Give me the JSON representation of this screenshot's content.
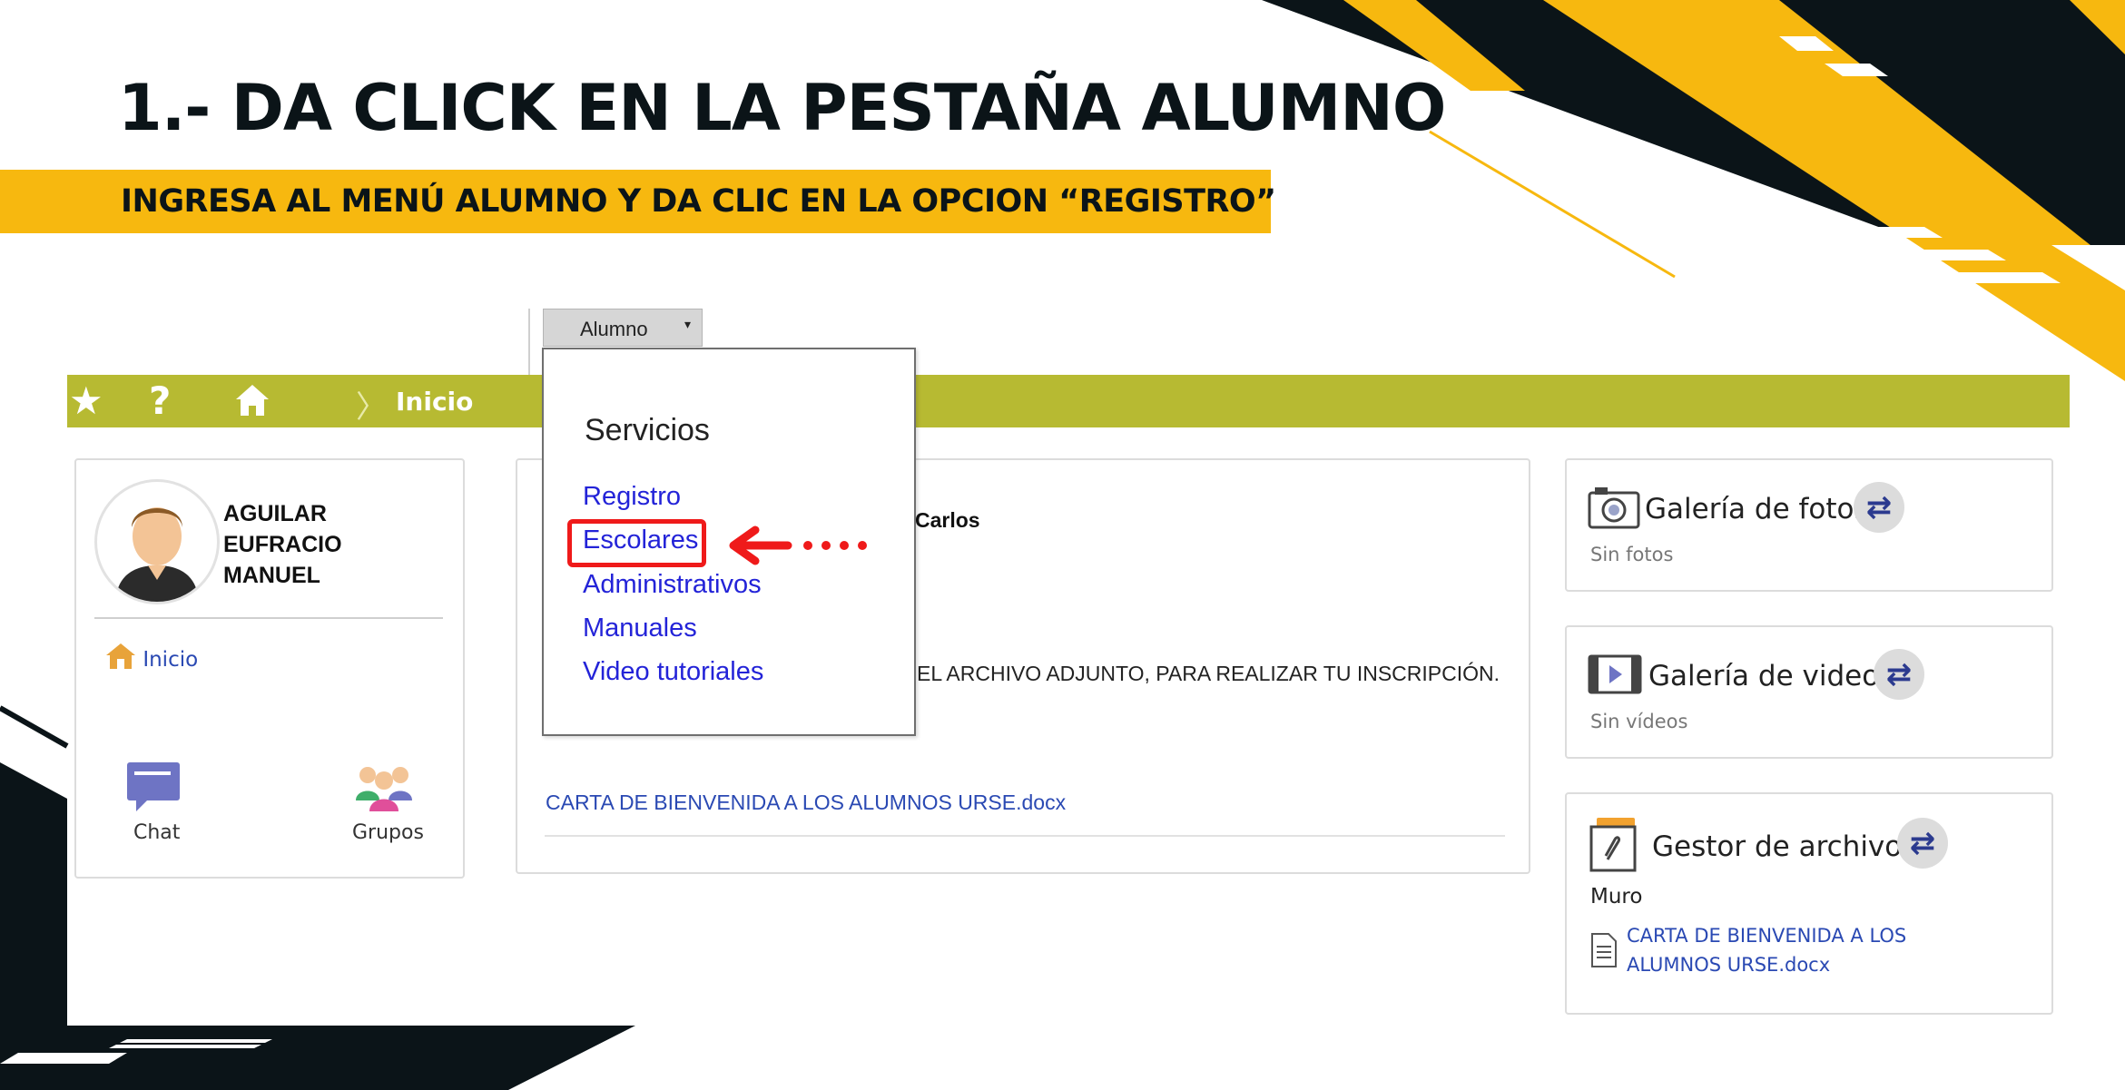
{
  "slide": {
    "title": "1.- DA CLICK EN LA PESTAÑA ALUMNO",
    "subtitle": "INGRESA AL MENÚ ALUMNO Y DA CLIC EN LA OPCION “REGISTRO”"
  },
  "menu_tab": {
    "label": "Alumno",
    "caret": "▾"
  },
  "topbar": {
    "favorites_icon": "★",
    "help_icon": "?",
    "separator": "〉",
    "breadcrumb": "Inicio"
  },
  "dropdown": {
    "heading": "Servicios",
    "items": [
      "Registro",
      "Escolares",
      "Administrativos",
      "Manuales",
      "Video tutoriales"
    ],
    "highlighted": "Escolares"
  },
  "profile": {
    "name": "AGUILAR EUFRACIO MANUEL",
    "home_link": "Inicio",
    "chat_label": "Chat",
    "groups_label": "Grupos"
  },
  "post": {
    "author_fragment": "Carlos",
    "text_fragment": "EL ARCHIVO ADJUNTO, PARA REALIZAR TU INSCRIPCIÓN.",
    "attachment": "CARTA DE BIENVENIDA A LOS ALUMNOS URSE.docx"
  },
  "widgets": {
    "photos": {
      "title": "Galería de fotos",
      "empty": "Sin fotos"
    },
    "videos": {
      "title": "Galería de videos",
      "empty": "Sin vídeos"
    },
    "files": {
      "title": "Gestor de archivos",
      "folder": "Muro",
      "file": "CARTA DE BIENVENIDA A LOS ALUMNOS URSE.docx"
    },
    "refresh_glyph": "⇄"
  },
  "colors": {
    "accent_yellow": "#f7b80f",
    "dark": "#0b1418",
    "topbar_olive": "#b7ba32",
    "link_blue": "#2323d8",
    "highlight_red": "#ef1a1a"
  }
}
